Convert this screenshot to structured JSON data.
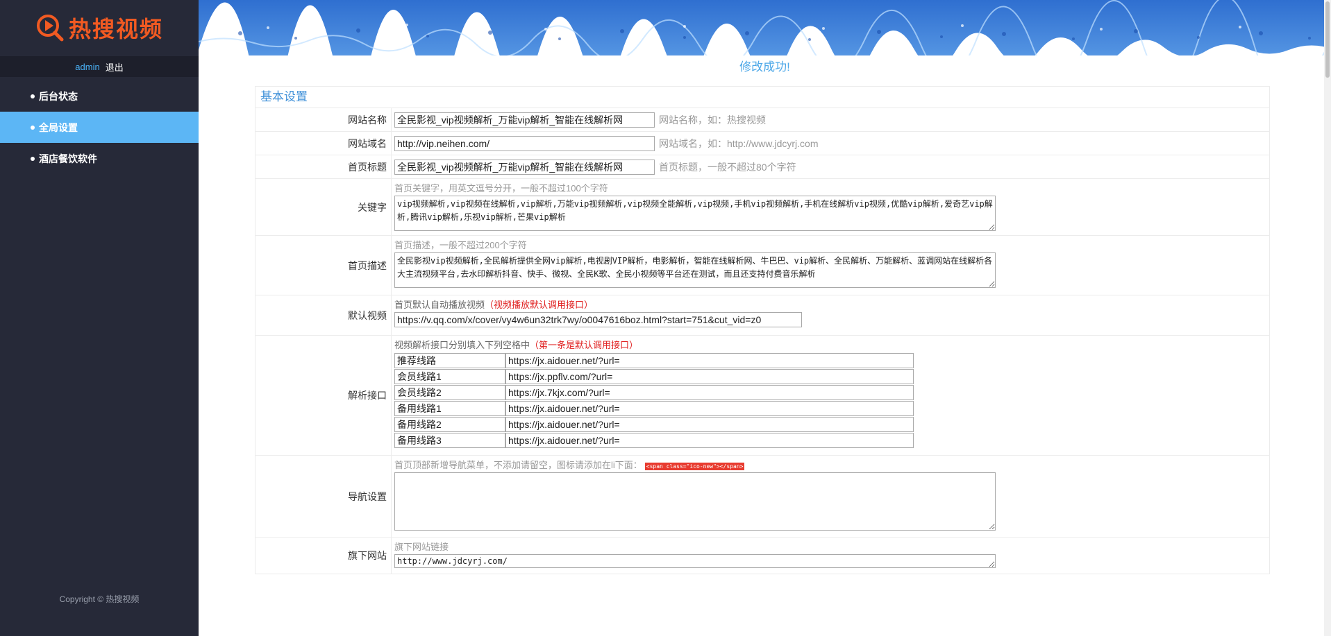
{
  "sidebar": {
    "logo_text": "热搜视频",
    "user": "admin",
    "logout": "退出",
    "items": [
      {
        "label": "后台状态",
        "active": false
      },
      {
        "label": "全局设置",
        "active": true
      },
      {
        "label": "酒店餐饮软件",
        "active": false
      }
    ],
    "copyright": "Copyright © 热搜视频"
  },
  "notice": "修改成功!",
  "panel": {
    "title": "基本设置",
    "site_name": {
      "label": "网站名称",
      "value": "全民影视_vip视频解析_万能vip解析_智能在线解析网",
      "hint": "网站名称，如：热搜视频"
    },
    "site_domain": {
      "label": "网站域名",
      "value": "http://vip.neihen.com/",
      "hint": "网站域名，如：http://www.jdcyrj.com"
    },
    "home_title": {
      "label": "首页标题",
      "value": "全民影视_vip视频解析_万能vip解析_智能在线解析网",
      "hint": "首页标题，一般不超过80个字符"
    },
    "keywords": {
      "label": "关键字",
      "hint": "首页关键字，用英文逗号分开，一般不超过100个字符",
      "value": "vip视频解析,vip视频在线解析,vip解析,万能vip视频解析,vip视频全能解析,vip视频,手机vip视频解析,手机在线解析vip视频,优酷vip解析,爱奇艺vip解析,腾讯vip解析,乐视vip解析,芒果vip解析"
    },
    "description": {
      "label": "首页描述",
      "hint": "首页描述，一般不超过200个字符",
      "value": "全民影视vip视频解析,全民解析提供全网vip解析,电视剧VIP解析，电影解析，智能在线解析网、牛巴巴、vip解析、全民解析、万能解析、蓝调网站在线解析各大主流视频平台,去水印解析抖音、快手、微视、全民K歌、全民小视频等平台还在测试，而且还支持付费音乐解析"
    },
    "default_video": {
      "label": "默认视频",
      "hint": "首页默认自动播放视频",
      "hint_red": "（视频播放默认调用接口）",
      "value": "https://v.qq.com/x/cover/vy4w6un32trk7wy/o0047616boz.html?start=751&cut_vid=z0"
    },
    "parse_api": {
      "label": "解析接口",
      "hint": "视频解析接口分别填入下列空格中",
      "hint_red": "（第一条是默认调用接口）",
      "lines": [
        {
          "name": "推荐线路",
          "url": "https://jx.aidouer.net/?url="
        },
        {
          "name": "会员线路1",
          "url": "https://jx.ppflv.com/?url="
        },
        {
          "name": "会员线路2",
          "url": "https://jx.7kjx.com/?url="
        },
        {
          "name": "备用线路1",
          "url": "https://jx.aidouer.net/?url="
        },
        {
          "name": "备用线路2",
          "url": "https://jx.aidouer.net/?url="
        },
        {
          "name": "备用线路3",
          "url": "https://jx.aidouer.net/?url="
        }
      ]
    },
    "nav_settings": {
      "label": "导航设置",
      "hint": "首页顶部新增导航菜单，不添加请留空，图标请添加在li下面：",
      "code": "<span class=\"ico-new\"></span>",
      "value": ""
    },
    "sub_sites": {
      "label": "旗下网站",
      "hint": "旗下网站链接",
      "value": "http://www.jdcyrj.com/"
    }
  },
  "colors": {
    "sidebar_bg": "#262938",
    "active_item": "#5cb6f5",
    "logo_orange": "#f15a22",
    "title_blue": "#3d8fd8",
    "hint_red": "#e02020"
  },
  "icons": {
    "logo": "play-search-icon"
  }
}
